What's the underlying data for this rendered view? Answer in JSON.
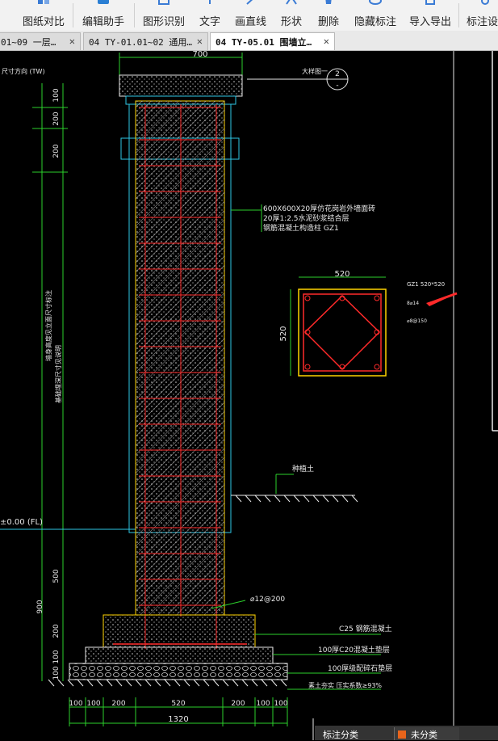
{
  "toolbar": {
    "items": [
      {
        "label": "图纸对比",
        "icon": "compare-icon"
      },
      {
        "label": "编辑助手",
        "icon": "edit-assistant-icon"
      },
      {
        "label": "图形识别",
        "icon": "shape-recognition-icon"
      },
      {
        "label": "文字",
        "icon": "text-icon"
      },
      {
        "label": "画直线",
        "icon": "draw-line-icon"
      },
      {
        "label": "形状",
        "icon": "shape-icon"
      },
      {
        "label": "删除",
        "icon": "delete-icon"
      },
      {
        "label": "隐藏标注",
        "icon": "hide-annotation-icon"
      },
      {
        "label": "导入导出",
        "icon": "import-export-icon"
      },
      {
        "label": "标注设置",
        "icon": "annotation-settings-icon"
      }
    ]
  },
  "tabs": [
    {
      "label": "01~09 一层…",
      "active": false
    },
    {
      "label": "04 TY-01.01~02 通用…",
      "active": false
    },
    {
      "label": "04 TY-05.01 围墙立…",
      "active": true
    }
  ],
  "drawing": {
    "top_width": "700",
    "left_note": "尺寸方向 (TW)",
    "left_dims": [
      "100",
      "200",
      "200"
    ],
    "vert_label_1": "墙身高度见立面尺寸标注",
    "vert_label_2": "基础埋深尺寸见说明",
    "level_label": "±0.00 (FL)",
    "bottom_dims_left": [
      "500",
      "900",
      "200",
      "100",
      "100"
    ],
    "detail_callout": "大样图一",
    "callout_top": "2",
    "callout_bottom": "-",
    "layers": [
      "600X600X20厚仿花岗岩外墙面砖",
      "20厚1:2.5水泥砂浆结合层",
      "钢筋混凝土构造柱 GZ1"
    ],
    "section_width": "520",
    "section_height": "520",
    "gz1_title": "GZ1 520*520",
    "gz1_main_bar": "8⌀14",
    "gz1_stirrup": "⌀8@150",
    "soil_label": "种植土",
    "stirrup_note": "⌀12@200",
    "base_layers": [
      "C25 钢筋混凝土",
      "100厚C20混凝土垫层",
      "100厚级配碎石垫层",
      "素土夯实 压实系数≥93%"
    ],
    "bottom_dims": [
      "100",
      "100",
      "200",
      "520",
      "200",
      "100",
      "100"
    ],
    "total_width": "1320"
  },
  "status": {
    "annotation_category": "标注分类",
    "category_value": "未分类",
    "category_color": "#e8641b"
  },
  "colors": {
    "accent_orange": "#e8641b",
    "cad_red": "#ff2a2a",
    "cad_yellow": "#ffd400",
    "cad_cyan": "#2ec7e6",
    "cad_white": "#e8e8e8",
    "cad_green": "#2bd12b"
  }
}
